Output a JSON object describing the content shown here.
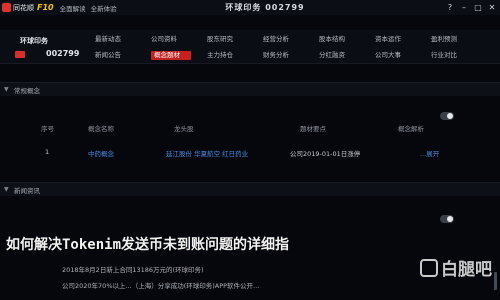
{
  "topbar": {
    "brand_name": "同花顺",
    "brand_version": "F10",
    "menu": [
      "全面解读",
      "全新体验"
    ],
    "banner": "环球印务 002799",
    "window_controls": [
      "?",
      "–",
      "▢",
      "✕"
    ]
  },
  "stock": {
    "name": "环球印务",
    "code": "002799"
  },
  "quote_grid": [
    [
      "最新动态",
      "公司资料",
      "股东研究",
      "经营分析",
      "股本结构",
      "资本运作",
      "盈利预测"
    ],
    [
      "新闻公告",
      "概念题材",
      "主力持仓",
      "财务分析",
      "分红融资",
      "公司大事",
      "行业对比"
    ]
  ],
  "concept_panel": {
    "title": "常规概念",
    "columns": [
      "序号",
      "概念名称",
      "龙头股",
      "题材要点",
      "概念解析"
    ],
    "rows": [
      {
        "index": "1",
        "name": "中药概念",
        "leaders": "延江股份  华夏航空  红日药业",
        "detail": "公司2019-01-01日涨停",
        "more": "...展开"
      }
    ]
  },
  "news_panel": {
    "title": "新闻资讯",
    "lines": [
      "2018年8月2日新上合同13186万元的(环球印务)",
      "公司2020年70%以上...（上海）分享成功(环球印务)APP软件公开..."
    ]
  },
  "overlay_title": "如何解决Tokenim发送币未到账问题的详细指",
  "watermark": "白腿吧",
  "colors": {
    "accent_red": "#c61f1f",
    "link_blue": "#4a8ee8",
    "brand_yellow": "#f5c400"
  }
}
